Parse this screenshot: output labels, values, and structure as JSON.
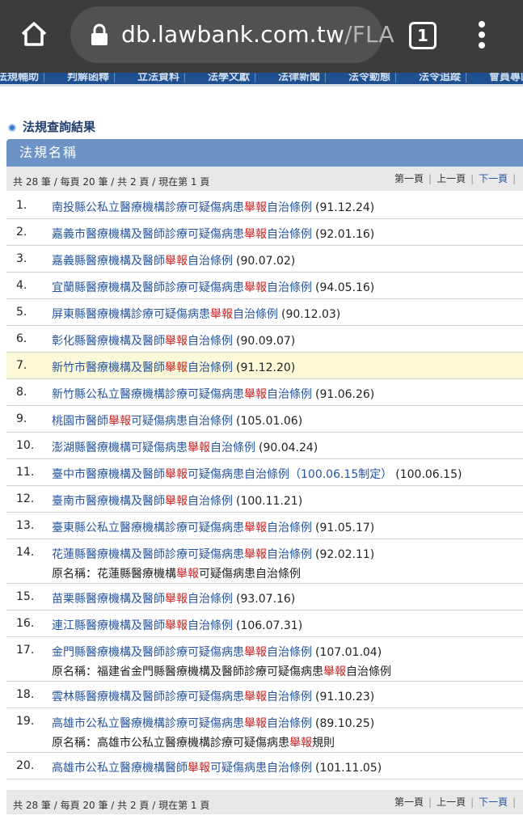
{
  "browser": {
    "url_main": "db.lawbank.com.tw",
    "url_rest": "/FLA",
    "tab_count": "1"
  },
  "site_nav": [
    "法規輔助",
    "判解函釋",
    "立法資料",
    "法學文獻",
    "法律新聞",
    "法令動態",
    "法令追蹤",
    "會員專區"
  ],
  "section_title": "法規查詢結果",
  "table_header": "法規名稱",
  "pager": {
    "info": "共 28 筆 / 每頁 20 筆 / 共 2 頁 / 現在第 1 頁",
    "first": "第一頁",
    "prev": "上一頁",
    "next": "下一頁",
    "sep": "|"
  },
  "keyword": "舉報",
  "results": [
    {
      "num": "1.",
      "pre": "南投縣公私立醫療機構診療可疑傷病患",
      "post": "自治條例",
      "date": "(91.12.24)"
    },
    {
      "num": "2.",
      "pre": "嘉義市醫療機構及醫師診療可疑傷病患",
      "post": "自治條例",
      "date": "(92.01.16)"
    },
    {
      "num": "3.",
      "pre": "嘉義縣醫療機構及醫師",
      "post": "自治條例",
      "date": "(90.07.02)"
    },
    {
      "num": "4.",
      "pre": "宜蘭縣醫療機構及醫師診療可疑傷病患",
      "post": "自治條例",
      "date": "(94.05.16)"
    },
    {
      "num": "5.",
      "pre": "屏東縣醫療機構診療可疑傷病患",
      "post": "自治條例",
      "date": "(90.12.03)"
    },
    {
      "num": "6.",
      "pre": "彰化縣醫療機構及醫師",
      "post": "自治條例",
      "date": "(90.09.07)"
    },
    {
      "num": "7.",
      "pre": "新竹市醫療機構及醫師",
      "post": "自治條例",
      "date": "(91.12.20)",
      "highlight": "true"
    },
    {
      "num": "8.",
      "pre": "新竹縣公私立醫療機構診療可疑傷病患",
      "post": "自治條例",
      "date": "(91.06.26)"
    },
    {
      "num": "9.",
      "pre": "桃園市醫師",
      "post": "可疑傷病患自治條例",
      "date": "(105.01.06)"
    },
    {
      "num": "10.",
      "pre": "澎湖縣醫療機構可疑傷病患",
      "post": "自治條例",
      "date": "(90.04.24)"
    },
    {
      "num": "11.",
      "pre": "臺中市醫療機構及醫師",
      "post": "可疑傷病患自治條例（100.06.15制定）",
      "date": "(100.06.15)"
    },
    {
      "num": "12.",
      "pre": "臺南市醫療機構及醫師",
      "post": "自治條例",
      "date": "(100.11.21)"
    },
    {
      "num": "13.",
      "pre": "臺東縣公私立醫療機構診療可疑傷病患",
      "post": "自治條例",
      "date": "(91.05.17)"
    },
    {
      "num": "14.",
      "pre": "花蓮縣醫療機構及醫師診療可疑傷病患",
      "post": "自治條例",
      "date": "(92.02.11)",
      "orig_label": "原名稱：",
      "orig_pre": "花蓮縣醫療機構",
      "orig_post": "可疑傷病患自治條例"
    },
    {
      "num": "15.",
      "pre": "苗栗縣醫療機構及醫師",
      "post": "自治條例",
      "date": "(93.07.16)"
    },
    {
      "num": "16.",
      "pre": "連江縣醫療機構及醫師",
      "post": "自治條例",
      "date": "(106.07.31)"
    },
    {
      "num": "17.",
      "pre": "金門縣醫療機構及醫師診療可疑傷病患",
      "post": "自治條例",
      "date": "(107.01.04)",
      "orig_label": "原名稱：",
      "orig_pre": "福建省金門縣醫療機構及醫師診療可疑傷病患",
      "orig_post": "自治條例"
    },
    {
      "num": "18.",
      "pre": "雲林縣醫療機構及醫師診療可疑傷病患",
      "post": "自治條例",
      "date": "(91.10.23)"
    },
    {
      "num": "19.",
      "pre": "高雄市公私立醫療機構診療可疑傷病患",
      "post": "自治條例",
      "date": "(89.10.25)",
      "orig_label": "原名稱：",
      "orig_pre": "高雄市公私立醫療機構診療可疑傷病患",
      "orig_post": "規則"
    },
    {
      "num": "20.",
      "pre": "高雄市公私立醫療機構醫師",
      "post": "可疑傷病患自治條例",
      "date": "(101.11.05)"
    }
  ]
}
